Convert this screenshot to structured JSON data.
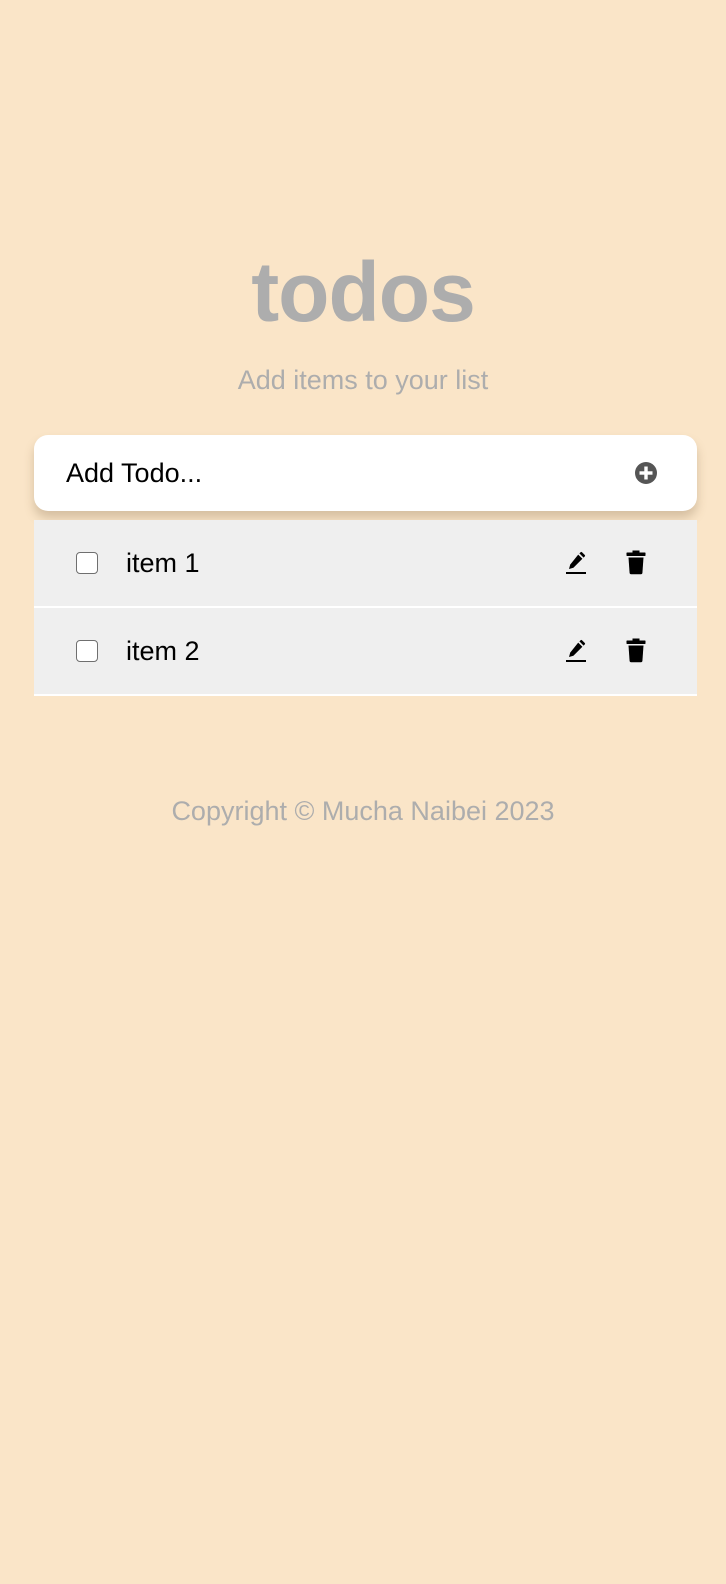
{
  "header": {
    "title": "todos",
    "subtitle": "Add items to your list"
  },
  "add_form": {
    "placeholder": "Add Todo...",
    "value": "",
    "add_icon": "plus-circle-icon"
  },
  "todos": [
    {
      "label": "item 1",
      "checked": false,
      "edit_icon": "pencil-icon",
      "delete_icon": "trash-icon"
    },
    {
      "label": "item 2",
      "checked": false,
      "edit_icon": "pencil-icon",
      "delete_icon": "trash-icon"
    }
  ],
  "footer": {
    "copyright": "Copyright © Mucha Naibei 2023"
  },
  "colors": {
    "background": "#fae5c8",
    "muted_text": "#adadad",
    "card": "#ffffff",
    "list_item": "#efefef"
  }
}
